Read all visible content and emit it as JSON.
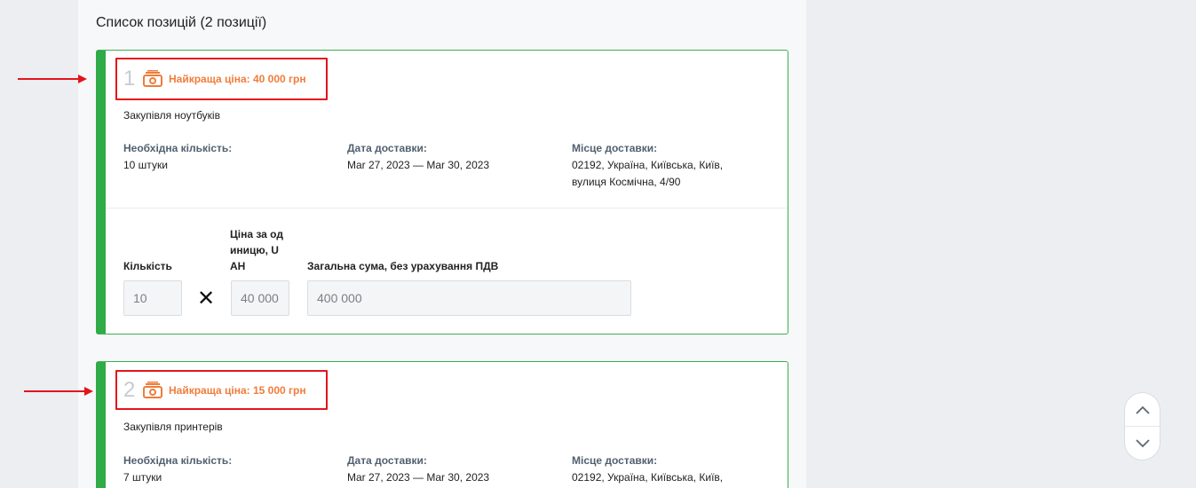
{
  "list": {
    "title": "Список позицій (2 позиції)"
  },
  "items": [
    {
      "number": "1",
      "best_price": "Найкраща ціна: 40 000 грн",
      "description": "Закупівля ноутбуків",
      "quantity_label": "Необхідна кількість:",
      "quantity_value": "10 штуки",
      "delivery_date_label": "Дата доставки:",
      "delivery_date_value": "Mar 27, 2023 — Mar 30, 2023",
      "delivery_place_label": "Місце доставки:",
      "delivery_place_line1": "02192, Україна, Київська, Київ,",
      "delivery_place_line2": "вулиця Космічна, 4/90",
      "form": {
        "qty_label": "Кількість",
        "qty_value": "10",
        "multiply": "✕",
        "unit_price_label_1": "Ціна за од",
        "unit_price_label_2": "иницю, U",
        "unit_price_label_3": "AH",
        "unit_price_value": "40 000",
        "total_label": "Загальна сума, без урахування ПДВ",
        "total_value": "400 000"
      }
    },
    {
      "number": "2",
      "best_price": "Найкраща ціна: 15 000 грн",
      "description": "Закупівля принтерів",
      "quantity_label": "Необхідна кількість:",
      "quantity_value": "7 штуки",
      "delivery_date_label": "Дата доставки:",
      "delivery_date_value": "Mar 27, 2023 — Mar 30, 2023",
      "delivery_place_label": "Місце доставки:",
      "delivery_place_line1": "02192, Україна, Київська, Київ,"
    }
  ],
  "icons": {
    "price": "money-stack-icon",
    "scroll_up": "chevron-up-icon",
    "scroll_down": "chevron-down-icon",
    "annotation": "red-arrow-icon"
  },
  "colors": {
    "accent_green": "#2fab48",
    "best_price_orange": "#f07c3a",
    "highlight_red": "#e3151a"
  }
}
